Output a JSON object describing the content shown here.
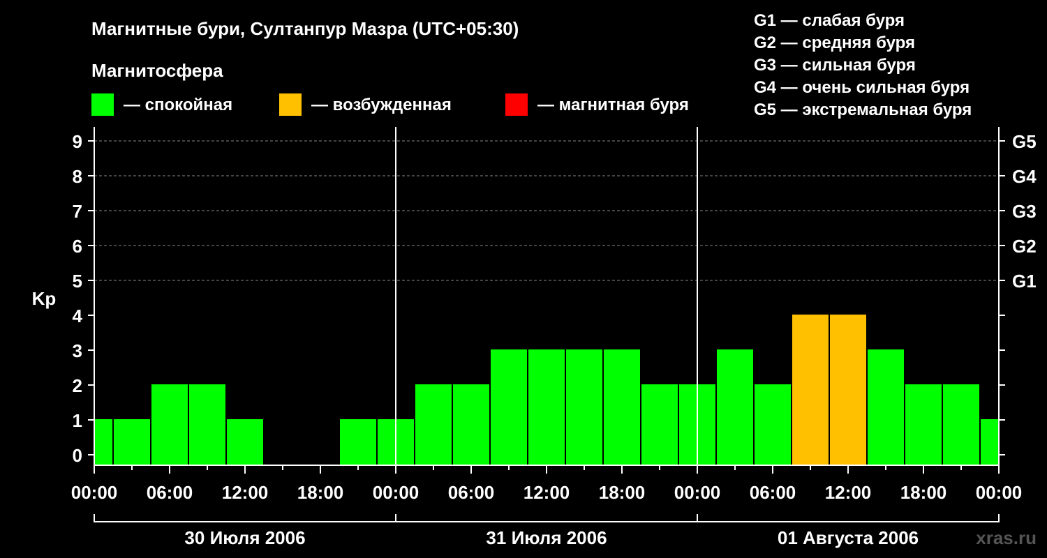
{
  "chart_data": {
    "type": "bar",
    "title": "Магнитные бури, Султанпур Мазра (UTC+05:30)",
    "subtitle": "Магнитосфера",
    "ylabel": "Kp",
    "ylim": [
      0,
      9
    ],
    "yticks": [
      "0",
      "1",
      "2",
      "3",
      "4",
      "5",
      "6",
      "7",
      "8",
      "9"
    ],
    "storm_levels": [
      {
        "kp": 5,
        "label": "G1"
      },
      {
        "kp": 6,
        "label": "G2"
      },
      {
        "kp": 7,
        "label": "G3"
      },
      {
        "kp": 8,
        "label": "G4"
      },
      {
        "kp": 9,
        "label": "G5"
      }
    ],
    "legend": [
      {
        "label": "— спокойная",
        "color": "#00ff00"
      },
      {
        "label": "— возбужденная",
        "color": "#ffc000"
      },
      {
        "label": "— магнитная буря",
        "color": "#ff0000"
      }
    ],
    "storm_legend": [
      "G1 — слабая буря",
      "G2 — средняя буря",
      "G3 — сильная буря",
      "G4 — очень сильная буря",
      "G5 — экстремальная буря"
    ],
    "xticks": [
      "00:00",
      "06:00",
      "12:00",
      "18:00",
      "00:00",
      "06:00",
      "12:00",
      "18:00",
      "00:00",
      "06:00",
      "12:00",
      "18:00",
      "00:00"
    ],
    "days": [
      "30 Июля 2006",
      "31 Июля 2006",
      "01 Августа 2006"
    ],
    "hours_total": 72,
    "bars": [
      {
        "start": 0,
        "end": 1.5,
        "value": 1,
        "color": "#00ff00"
      },
      {
        "start": 1.5,
        "end": 4.5,
        "value": 1,
        "color": "#00ff00"
      },
      {
        "start": 4.5,
        "end": 7.5,
        "value": 2,
        "color": "#00ff00"
      },
      {
        "start": 7.5,
        "end": 10.5,
        "value": 2,
        "color": "#00ff00"
      },
      {
        "start": 10.5,
        "end": 13.5,
        "value": 1,
        "color": "#00ff00"
      },
      {
        "start": 13.5,
        "end": 16.5,
        "value": 0,
        "color": "#00ff00"
      },
      {
        "start": 16.5,
        "end": 19.5,
        "value": 0,
        "color": "#00ff00"
      },
      {
        "start": 19.5,
        "end": 22.5,
        "value": 1,
        "color": "#00ff00"
      },
      {
        "start": 22.5,
        "end": 25.5,
        "value": 1,
        "color": "#00ff00"
      },
      {
        "start": 25.5,
        "end": 28.5,
        "value": 2,
        "color": "#00ff00"
      },
      {
        "start": 28.5,
        "end": 31.5,
        "value": 2,
        "color": "#00ff00"
      },
      {
        "start": 31.5,
        "end": 34.5,
        "value": 3,
        "color": "#00ff00"
      },
      {
        "start": 34.5,
        "end": 37.5,
        "value": 3,
        "color": "#00ff00"
      },
      {
        "start": 37.5,
        "end": 40.5,
        "value": 3,
        "color": "#00ff00"
      },
      {
        "start": 40.5,
        "end": 43.5,
        "value": 3,
        "color": "#00ff00"
      },
      {
        "start": 43.5,
        "end": 46.5,
        "value": 2,
        "color": "#00ff00"
      },
      {
        "start": 46.5,
        "end": 49.5,
        "value": 2,
        "color": "#00ff00"
      },
      {
        "start": 49.5,
        "end": 52.5,
        "value": 3,
        "color": "#00ff00"
      },
      {
        "start": 52.5,
        "end": 55.5,
        "value": 2,
        "color": "#00ff00"
      },
      {
        "start": 55.5,
        "end": 58.5,
        "value": 4,
        "color": "#ffc000"
      },
      {
        "start": 58.5,
        "end": 61.5,
        "value": 4,
        "color": "#ffc000"
      },
      {
        "start": 61.5,
        "end": 64.5,
        "value": 3,
        "color": "#00ff00"
      },
      {
        "start": 64.5,
        "end": 67.5,
        "value": 2,
        "color": "#00ff00"
      },
      {
        "start": 67.5,
        "end": 70.5,
        "value": 2,
        "color": "#00ff00"
      },
      {
        "start": 70.5,
        "end": 72,
        "value": 1,
        "color": "#00ff00"
      }
    ],
    "grid": "dashed at storm levels",
    "watermark": "xras.ru"
  }
}
